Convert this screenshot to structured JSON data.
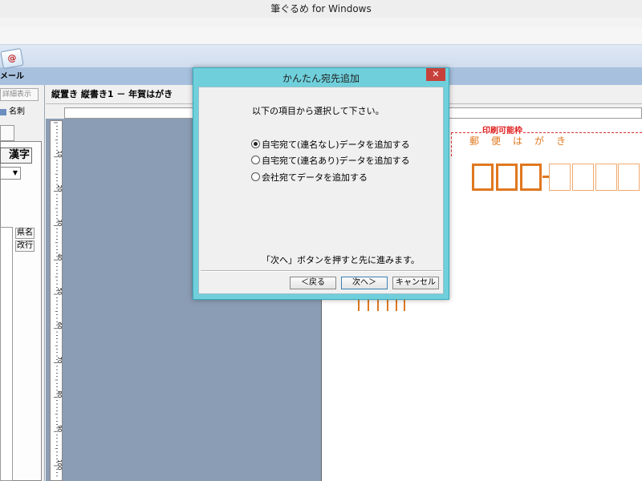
{
  "window": {
    "title": "筆ぐるめ for Windows"
  },
  "ribbon": {
    "mail_label": "メール",
    "mail_icon_glyph": "@"
  },
  "left_panel": {
    "detail_button": "詳細表示",
    "meishi_label": "名刺",
    "kanji_button": "漢字",
    "ken_button": "県名",
    "kaigyo_button": "改行"
  },
  "document": {
    "title": "縦置き 縦書き1 － 年賀はがき",
    "print_area_label": "印刷可能枠",
    "postcard_label": "郵便はがき",
    "ruler_marks": [
      "10",
      "20",
      "30",
      "40",
      "50",
      "60",
      "70",
      "80",
      "90",
      "100"
    ]
  },
  "dialog": {
    "title": "かんたん宛先追加",
    "close_glyph": "✕",
    "prompt": "以下の項目から選択して下さい。",
    "options": [
      {
        "label": "自宅宛て(連名なし)データを追加する",
        "selected": true
      },
      {
        "label": "自宅宛て(連名あり)データを追加する",
        "selected": false
      },
      {
        "label": "会社宛てデータを追加する",
        "selected": false
      }
    ],
    "hint": "「次へ」ボタンを押すと先に進みます。",
    "buttons": {
      "back": "＜戻る",
      "next": "次へ＞",
      "cancel": "キャンセル"
    }
  },
  "colors": {
    "accent": "#6fd0dc",
    "postcard_orange": "#e07820",
    "print_frame": "#e03030"
  }
}
